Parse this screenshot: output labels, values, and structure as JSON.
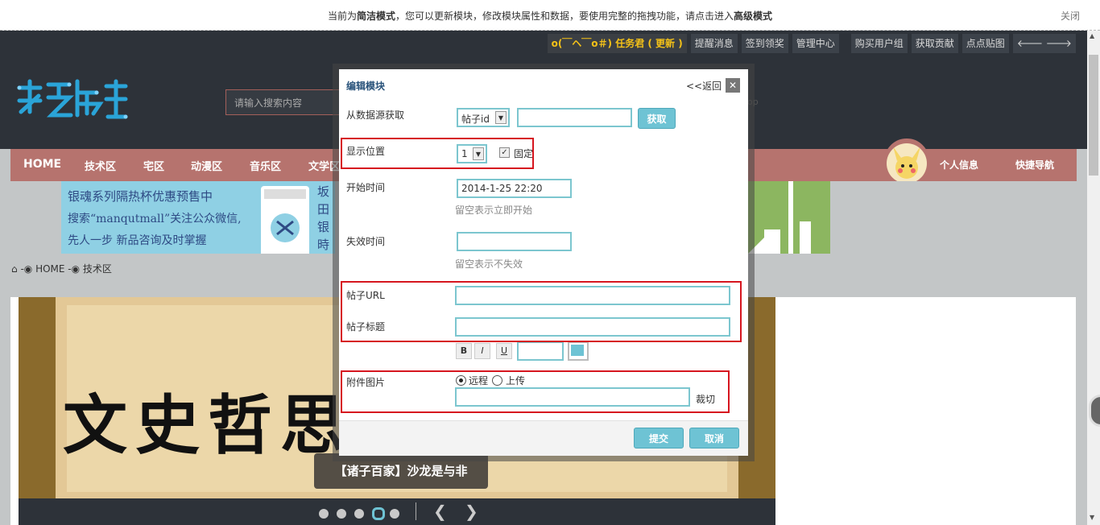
{
  "notice": {
    "prefix": "当前为",
    "mode": "简洁模式",
    "middle": "，您可以更新模块，修改模块属性和数据，要使用完整的拖拽功能，请点击进入",
    "advanced": "高级模式",
    "close": "关闭"
  },
  "topbar": {
    "task": "o(￣ヘ￣o＃) 任务君 ( 更新 )",
    "items": [
      "提醒消息",
      "签到领奖",
      "管理中心",
      "购买用户组",
      "获取贡献",
      "点点贴图"
    ],
    "arrows": "🡐 🡒"
  },
  "search": {
    "placeholder": "请输入搜索内容"
  },
  "ghost": "op",
  "nav": {
    "items": [
      "HOME",
      "技术区",
      "宅区",
      "动漫区",
      "音乐区",
      "文学区"
    ],
    "profile": "个人信息",
    "quick": "快捷导航"
  },
  "ad": {
    "line1": "银魂系列隔热杯优惠预售中",
    "line2": "搜索“manqutmall”关注公众微信,",
    "line3": "先人一步 新品咨询及时掌握",
    "side": "坂\n田\n银\n時"
  },
  "breadcrumb": {
    "home": "HOME",
    "section": "技术区"
  },
  "slide": {
    "big": "文史哲思",
    "caption": "【诸子百家】沙龙是与非"
  },
  "dialog": {
    "title": "编辑模块",
    "back": "<<返回",
    "close": "✕",
    "source_label": "从数据源获取",
    "source_select": "帖子id",
    "source_input": "",
    "fetch": "获取",
    "position_label": "显示位置",
    "position_value": "1",
    "fixed_label": "固定",
    "start_label": "开始时间",
    "start_value": "2014-1-25 22:20",
    "start_hint": "留空表示立即开始",
    "end_label": "失效时间",
    "end_value": "",
    "end_hint": "留空表示不失效",
    "url_label": "帖子URL",
    "url_value": "",
    "title_label": "帖子标题",
    "title_value": "",
    "fmt_b": "B",
    "fmt_i": "I",
    "fmt_u": "U",
    "image_label": "附件图片",
    "remote": "远程",
    "upload": "上传",
    "image_value": "",
    "crop": "裁切",
    "submit": "提交",
    "cancel": "取消"
  },
  "colors": {
    "accent": "#6ec3d4",
    "nav": "#b6736e",
    "header": "#2d3239",
    "highlight": "#d6161f"
  }
}
